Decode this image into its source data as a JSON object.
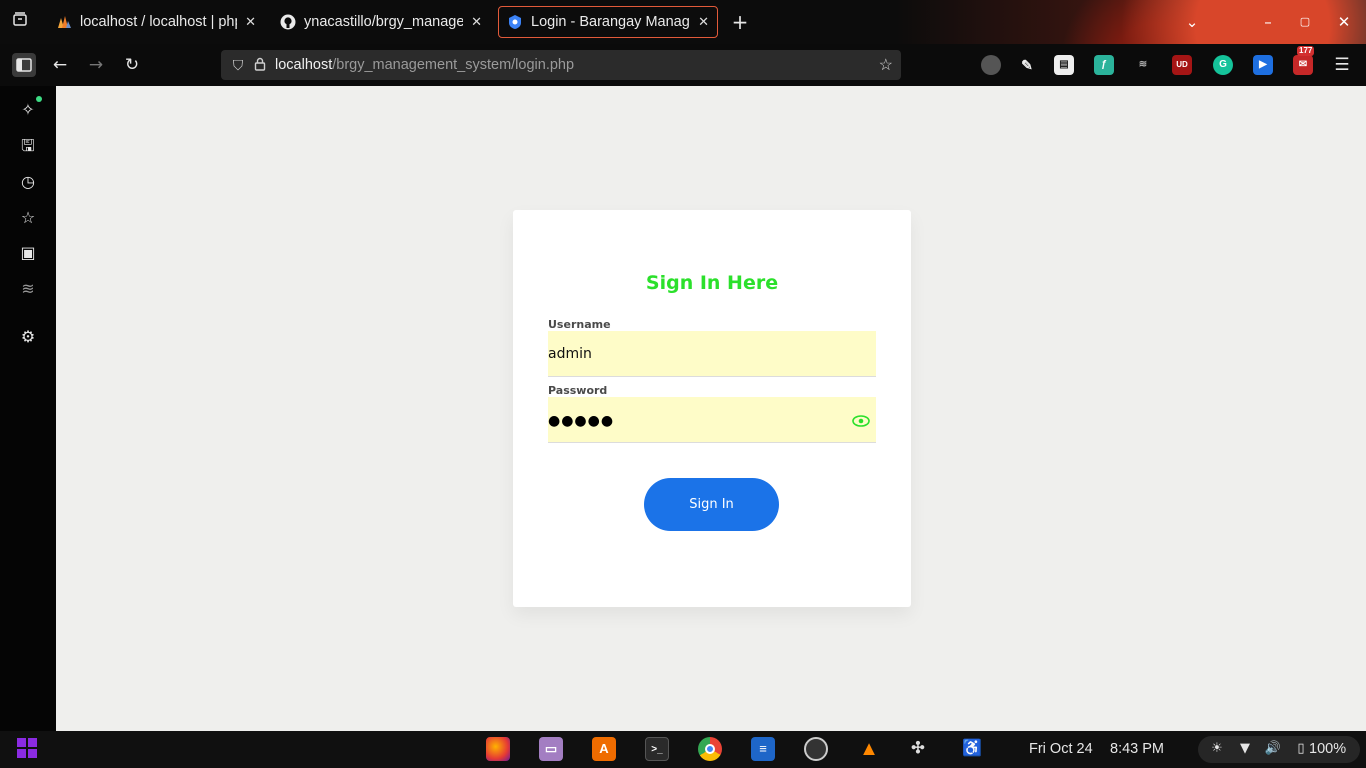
{
  "browser": {
    "tabs": [
      {
        "title": "localhost / localhost | php",
        "favicon": "phpmyadmin-icon",
        "active": false
      },
      {
        "title": "ynacastillo/brgy_manager",
        "favicon": "github-icon",
        "active": false
      },
      {
        "title": "Login - Barangay Manage",
        "favicon": "shield-favicon-icon",
        "active": true
      }
    ],
    "new_tab_symbol": "+",
    "url": {
      "host": "localhost",
      "path": "/brgy_management_system/login.php"
    },
    "extensions_badge": "177",
    "extension_labels": [
      "UD"
    ]
  },
  "login": {
    "title": "Sign In Here",
    "username_label": "Username",
    "username_value": "admin",
    "password_label": "Password",
    "password_masked": "●●●●●",
    "submit_label": "Sign In",
    "accent_color": "#2be02b",
    "button_color": "#1b73e8",
    "input_bg_color": "#fefcc8"
  },
  "taskbar": {
    "date": "Fri Oct 24",
    "time": "8:43 PM",
    "battery": "100%"
  }
}
